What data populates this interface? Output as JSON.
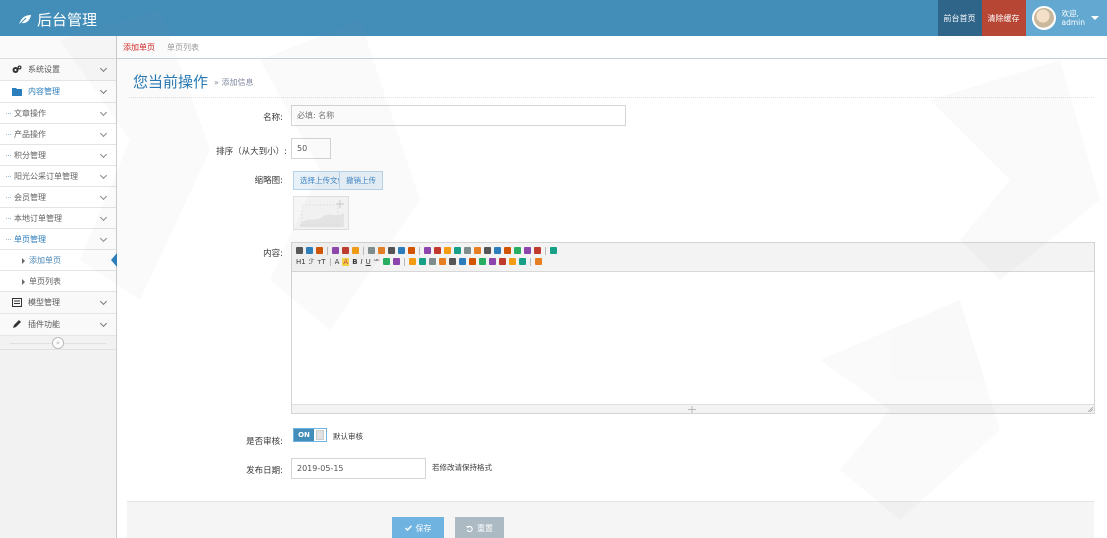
{
  "header": {
    "brand": "后台管理",
    "home_label": "前台首页",
    "clear_cache_label": "清除缓存",
    "welcome": "欢迎,",
    "username": "admin"
  },
  "sidebar": {
    "items": [
      {
        "label": "系统设置"
      },
      {
        "label": "内容管理"
      },
      {
        "label": "文章操作"
      },
      {
        "label": "产品操作"
      },
      {
        "label": "积分管理"
      },
      {
        "label": "阳光公采订单管理"
      },
      {
        "label": "会员管理"
      },
      {
        "label": "本地订单管理"
      },
      {
        "label": "单页管理"
      },
      {
        "label": "添加单页"
      },
      {
        "label": "单页列表"
      },
      {
        "label": "模型管理"
      },
      {
        "label": "插件功能"
      }
    ],
    "collapse_icon": "«"
  },
  "tabs": [
    "添加单页",
    "单页列表"
  ],
  "page": {
    "title": "您当前操作",
    "subtitle": "» 添加信息"
  },
  "form": {
    "name_label": "名称:",
    "name_placeholder": "必填: 名称",
    "order_label": "排序（从大到小）:",
    "order_value": "50",
    "thumb_label": "缩略图:",
    "upload_label": "选择上传文件",
    "cancel_upload_label": "撤销上传",
    "content_label": "内容:",
    "audit_label": "是否审核:",
    "audit_switch": "ON",
    "audit_note": "默认审核",
    "date_label": "发布日期:",
    "date_value": "2019-05-15",
    "date_note": "若修改请保持格式",
    "editor_row2": [
      "H1",
      "ℱ",
      "тT",
      "A",
      "A",
      "B",
      "I",
      "U",
      "ᴬᴮᶜ"
    ]
  },
  "actions": {
    "save_label": "保存",
    "reset_label": "重置"
  },
  "colors": {
    "navbar": "#438eb9",
    "cache_button": "#b74635",
    "home_button": "#2e6589",
    "active_tab": "#d12723",
    "save_button": "#6fb3e0",
    "reset_button": "#abbac3"
  }
}
